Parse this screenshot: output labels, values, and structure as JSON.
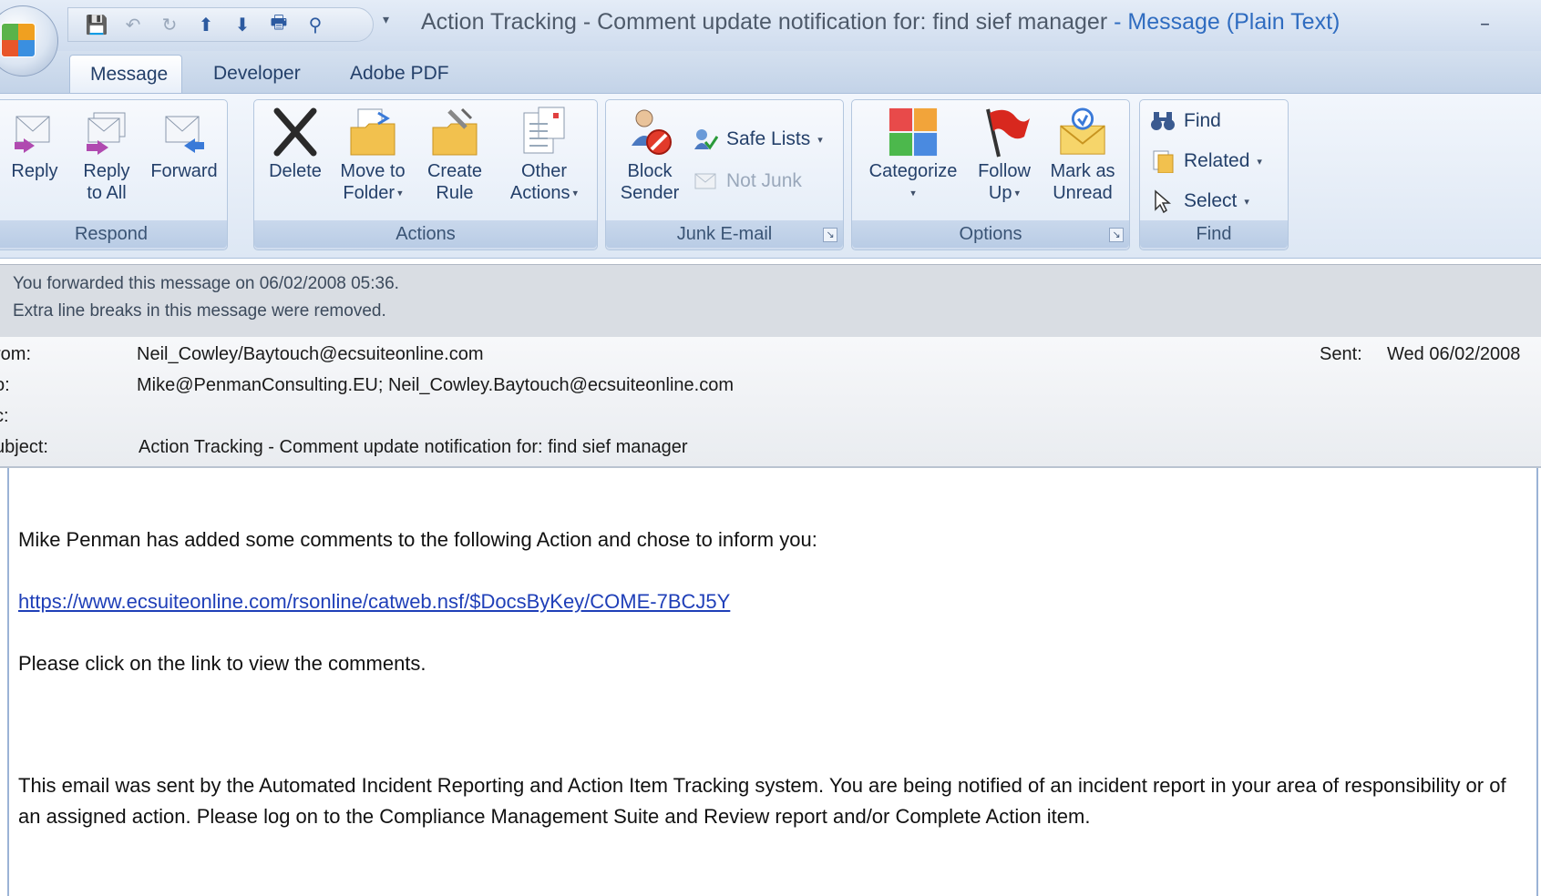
{
  "window": {
    "title_main": "Action Tracking - Comment update notification for: find sief manager",
    "title_accent": " - Message (Plain Text)",
    "minimize_glyph": "–"
  },
  "qat": {
    "save": "💾",
    "undo": "↶",
    "redo": "↻",
    "up": "⬆",
    "down": "⬇",
    "print": "🖶",
    "find": "⚲",
    "more": "▾"
  },
  "tabs": [
    {
      "label": "Message",
      "active": true
    },
    {
      "label": "Developer"
    },
    {
      "label": "Adobe PDF"
    }
  ],
  "ribbon": {
    "respond": {
      "label": "Respond",
      "reply": "Reply",
      "reply_all_1": "Reply",
      "reply_all_2": "to All",
      "forward": "Forward"
    },
    "actions": {
      "label": "Actions",
      "delete": "Delete",
      "move_1": "Move to",
      "move_2": "Folder",
      "create_1": "Create",
      "create_2": "Rule",
      "other_1": "Other",
      "other_2": "Actions"
    },
    "junk": {
      "label": "Junk E-mail",
      "block_1": "Block",
      "block_2": "Sender",
      "safe_lists": "Safe Lists",
      "not_junk": "Not Junk"
    },
    "options": {
      "label": "Options",
      "categorize": "Categorize",
      "follow_1": "Follow",
      "follow_2": "Up",
      "mark_1": "Mark as",
      "mark_2": "Unread"
    },
    "find": {
      "label": "Find",
      "find": "Find",
      "related": "Related",
      "select": "Select"
    }
  },
  "infobar": {
    "line1": "You forwarded this message on 06/02/2008 05:36.",
    "line2": "Extra line breaks in this message were removed."
  },
  "headers": {
    "from_label": "rom:",
    "from_value": "Neil_Cowley/Baytouch@ecsuiteonline.com",
    "to_label": "o:",
    "to_value": "Mike@PenmanConsulting.EU; Neil_Cowley.Baytouch@ecsuiteonline.com",
    "cc_label": "c:",
    "subject_label": "ubject:",
    "subject_value": "Action Tracking - Comment update notification for: find sief manager",
    "sent_label": "Sent:",
    "sent_value": "Wed 06/02/2008"
  },
  "body": {
    "p1": "Mike Penman has added some comments to the following Action and chose to inform you:",
    "link": "https://www.ecsuiteonline.com/rsonline/catweb.nsf/$DocsByKey/COME-7BCJ5Y",
    "p2": "Please click on the link to view the comments.",
    "p3": "This email was sent by the Automated Incident Reporting and Action Item Tracking system. You are being notified of an incident report in your area of responsibility or of an assigned action. Please log on to the Compliance Management Suite and Review report and/or Complete Action item."
  },
  "colors": {
    "link": "#1f3fb8",
    "title_accent": "#2f6cc0",
    "ribbon_text": "#24406a"
  }
}
